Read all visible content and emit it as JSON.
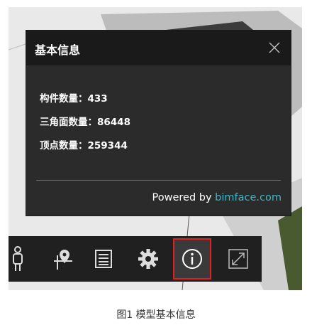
{
  "panel": {
    "title": "基本信息",
    "stats": [
      {
        "label": "构件数量：",
        "value": "433"
      },
      {
        "label": "三角面数量：",
        "value": "86448"
      },
      {
        "label": "顶点数量：",
        "value": "259344"
      }
    ],
    "powered_prefix": "Powered by ",
    "powered_link": "bimface.com",
    "close_icon": "close-icon"
  },
  "toolbar": {
    "icons": [
      "person-walk-icon",
      "map-pin-axis-icon",
      "list-document-icon",
      "gear-icon",
      "info-icon",
      "fullscreen-icon"
    ],
    "active_tool": "info-icon"
  },
  "caption": "图1  模型基本信息",
  "colors": {
    "accent": "#3fb5c8",
    "highlight": "#e02020",
    "panel_bg": "#2b2b2b",
    "toolbar_bg": "#202020"
  }
}
